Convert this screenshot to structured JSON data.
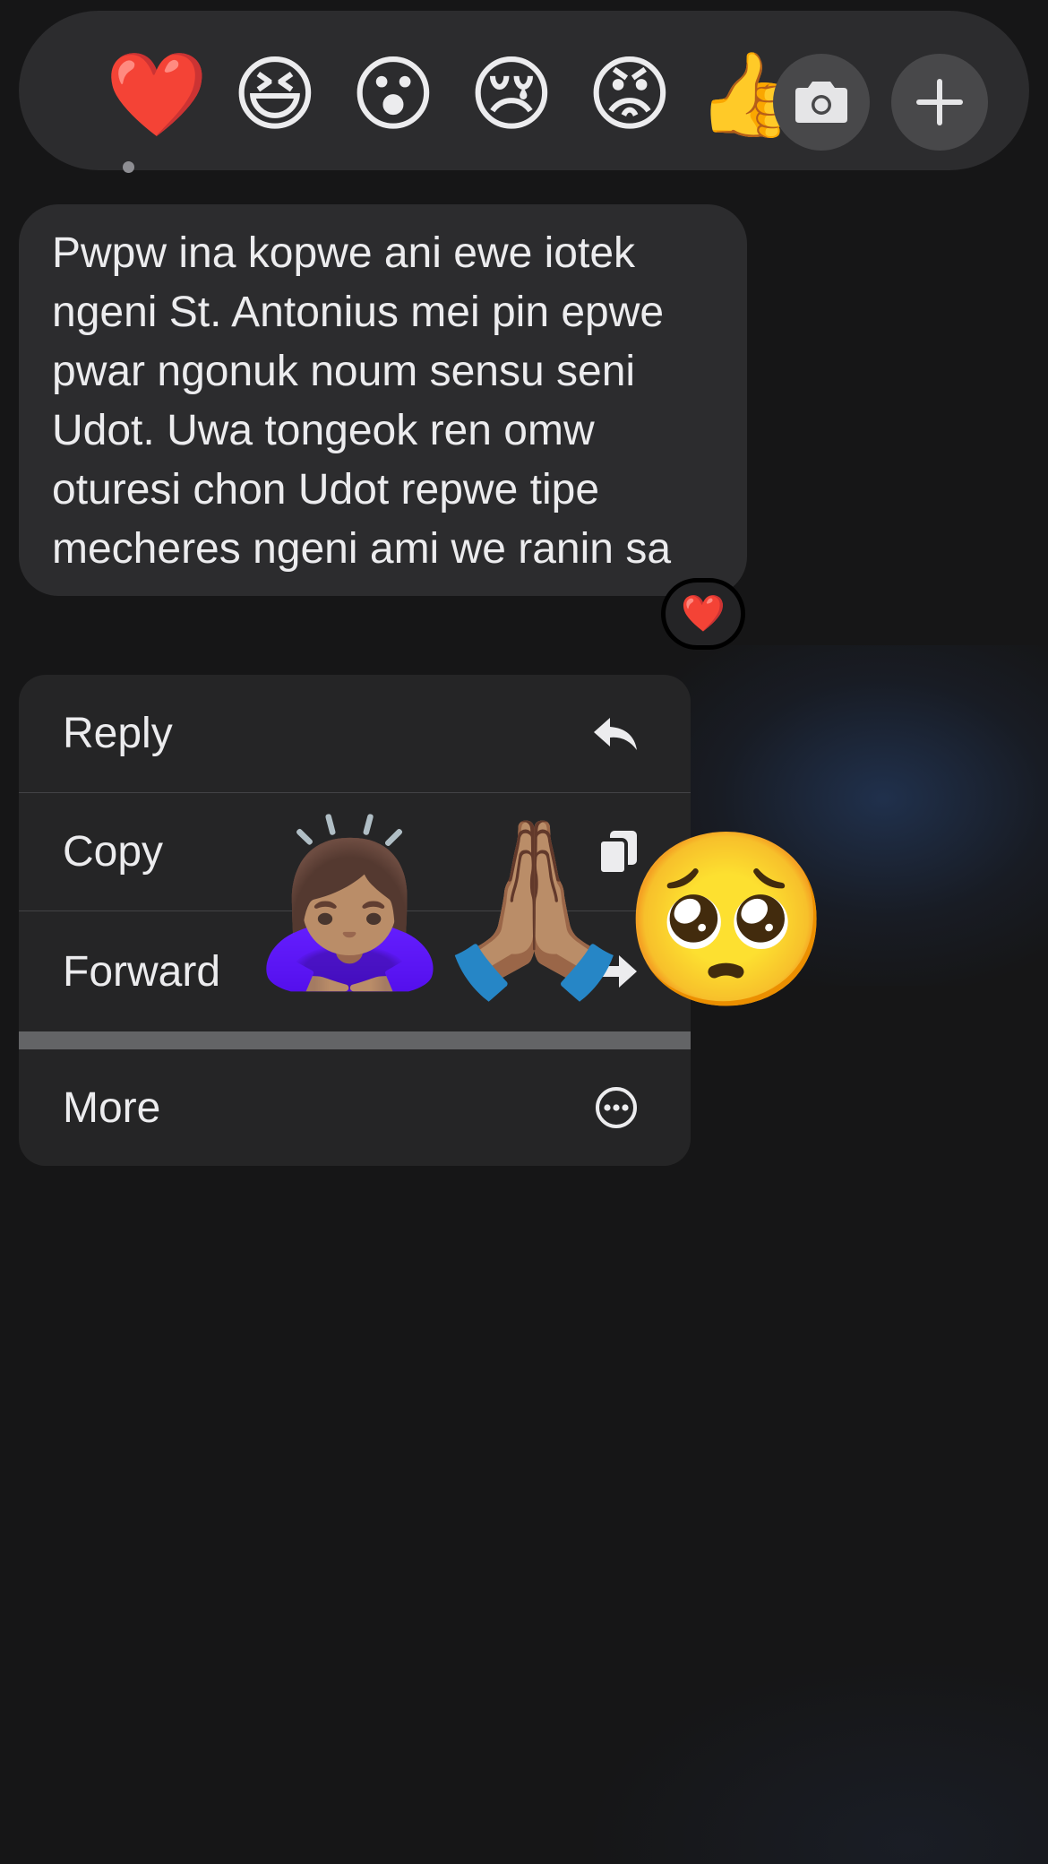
{
  "reaction_bar": {
    "reactions": [
      {
        "name": "heart",
        "glyph": "❤️",
        "selected": true
      },
      {
        "name": "laughing",
        "glyph": "😆",
        "selected": false
      },
      {
        "name": "surprised",
        "glyph": "😮",
        "selected": false
      },
      {
        "name": "crying",
        "glyph": "😢",
        "selected": false
      },
      {
        "name": "angry",
        "glyph": "😡",
        "selected": false
      },
      {
        "name": "thumbs-up",
        "glyph": "👍",
        "selected": false
      }
    ],
    "camera_icon": "camera-icon",
    "add_icon": "plus-icon"
  },
  "message": {
    "text": "Pwpw ina kopwe ani ewe iotek\nngeni St. Antonius mei pin epwe\npwar ngonuk noum sensu seni\nUdot. Uwa tongeok ren omw\noturesi chon Udot repwe tipe\nmecheres ngeni ami we ranin sa",
    "tapback": "❤️"
  },
  "menu": {
    "items": [
      {
        "label": "Reply",
        "icon": "reply-icon"
      },
      {
        "label": "Copy",
        "icon": "copy-icon"
      },
      {
        "label": "Forward",
        "icon": "forward-icon"
      },
      {
        "label": "More",
        "icon": "more-icon"
      }
    ]
  },
  "stickers": {
    "bowing": "🙇🏽‍♀️",
    "praying": "🙏🏽",
    "pleading": "🥺"
  },
  "colors": {
    "background": "#161617",
    "surface": "#2c2c2e",
    "menu_surface": "#252526",
    "text": "#ececee",
    "heart": "#ff2d2d"
  }
}
